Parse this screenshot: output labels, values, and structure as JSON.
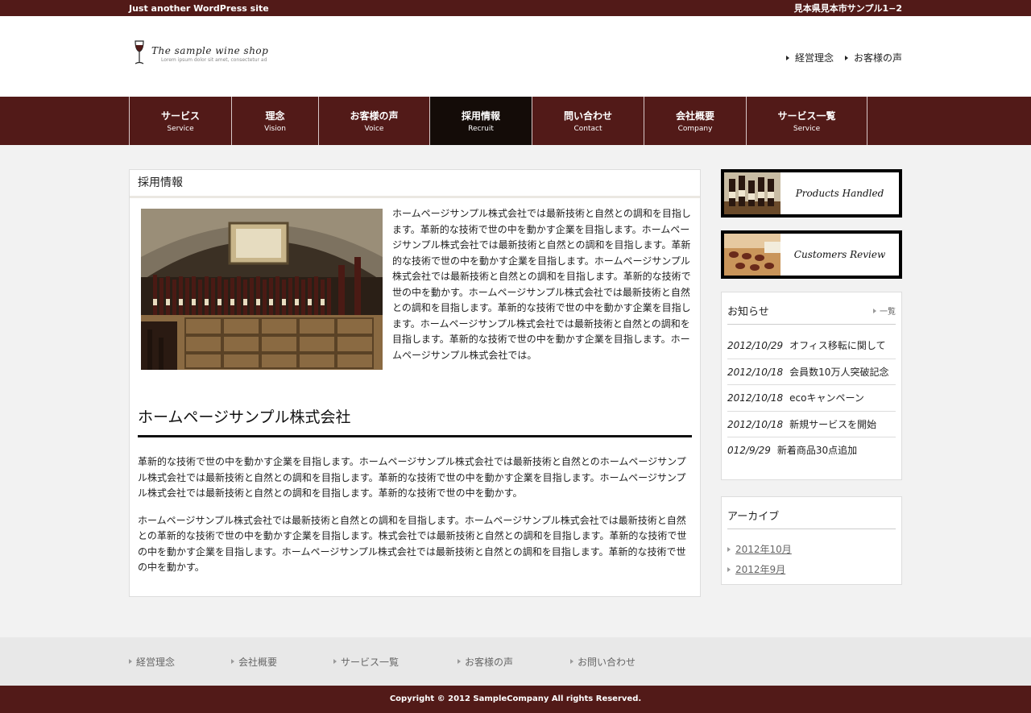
{
  "topbar": {
    "tagline": "Just another WordPress site",
    "address": "見本県見本市サンプル1−2"
  },
  "header": {
    "logo_name": "The sample wine shop",
    "logo_sub": "Lorem ipsum dolor sit amet, consectetur ad",
    "links": [
      {
        "label": "経営理念"
      },
      {
        "label": "お客様の声"
      }
    ]
  },
  "nav": {
    "items": [
      {
        "jp": "サービス",
        "en": "Service"
      },
      {
        "jp": "理念",
        "en": "Vision"
      },
      {
        "jp": "お客様の声",
        "en": "Voice"
      },
      {
        "jp": "採用情報",
        "en": "Recruit"
      },
      {
        "jp": "問い合わせ",
        "en": "Contact"
      },
      {
        "jp": "会社概要",
        "en": "Company"
      },
      {
        "jp": "サービス一覧",
        "en": "Service"
      }
    ],
    "active": "採用情報"
  },
  "content": {
    "title": "採用情報",
    "intro": "ホームページサンプル株式会社では最新技術と自然との調和を目指します。革新的な技術で世の中を動かす企業を目指します。ホームページサンプル株式会社では最新技術と自然との調和を目指します。革新的な技術で世の中を動かす企業を目指します。ホームページサンプル株式会社では最新技術と自然との調和を目指します。革新的な技術で世の中を動かす。ホームページサンプル株式会社では最新技術と自然との調和を目指します。革新的な技術で世の中を動かす企業を目指します。ホームページサンプル株式会社では最新技術と自然との調和を目指します。革新的な技術で世の中を動かす企業を目指します。ホームページサンプル株式会社では。",
    "heading": "ホームページサンプル株式会社",
    "para1": "革新的な技術で世の中を動かす企業を目指します。ホームページサンプル株式会社では最新技術と自然とのホームページサンプル株式会社では最新技術と自然との調和を目指します。革新的な技術で世の中を動かす企業を目指します。ホームページサンプル株式会社では最新技術と自然との調和を目指します。革新的な技術で世の中を動かす。",
    "para2": "ホームページサンプル株式会社では最新技術と自然との調和を目指します。ホームページサンプル株式会社では最新技術と自然との革新的な技術で世の中を動かす企業を目指します。株式会社では最新技術と自然との調和を目指します。革新的な技術で世の中を動かす企業を目指します。ホームページサンプル株式会社では最新技術と自然との調和を目指します。革新的な技術で世の中を動かす。"
  },
  "sidebar": {
    "banner1": "Products Handled",
    "banner2": "Customers Review",
    "news_title": "お知らせ",
    "news_more": "一覧",
    "news": [
      {
        "date": "2012/10/29",
        "text": "オフィス移転に関して"
      },
      {
        "date": "2012/10/18",
        "text": "会員数10万人突破記念"
      },
      {
        "date": "2012/10/18",
        "text": "ecoキャンペーン"
      },
      {
        "date": "2012/10/18",
        "text": "新規サービスを開始"
      },
      {
        "date": "012/9/29",
        "text": "新着商品30点追加"
      }
    ],
    "archive_title": "アーカイブ",
    "archive": [
      {
        "label": "2012年10月"
      },
      {
        "label": "2012年9月"
      }
    ]
  },
  "footer": {
    "links": [
      {
        "label": "経営理念"
      },
      {
        "label": "会社概要"
      },
      {
        "label": "サービス一覧"
      },
      {
        "label": "お客様の声"
      },
      {
        "label": "お問い合わせ"
      }
    ],
    "copyright": "Copyright © 2012 SampleCompany All rights Reserved."
  },
  "colors": {
    "brand": "#521a18",
    "nav_active": "#140c08"
  }
}
